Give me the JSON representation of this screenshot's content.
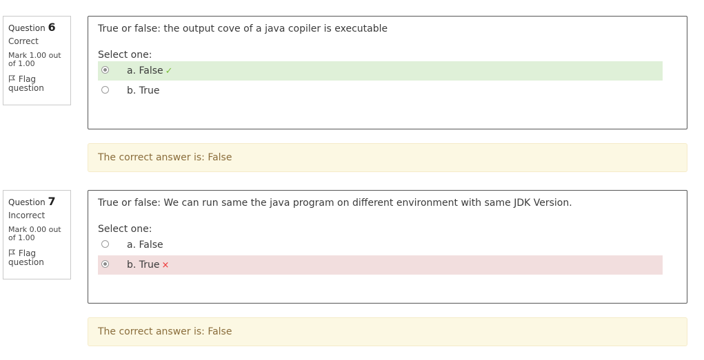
{
  "questions": [
    {
      "label": "Question",
      "number": "6",
      "state": "Correct",
      "grade": "Mark 1.00 out of 1.00",
      "flag": "Flag question",
      "text": "True or false: the output cove of a java copiler is executable",
      "prompt": "Select one:",
      "options": [
        {
          "label": "a. False",
          "selected": true,
          "mark": "✓"
        },
        {
          "label": "b. True",
          "selected": false,
          "mark": ""
        }
      ],
      "feedback": "The correct answer is: False"
    },
    {
      "label": "Question",
      "number": "7",
      "state": "Incorrect",
      "grade": "Mark 0.00 out of 1.00",
      "flag": "Flag question",
      "text": "True or false: We can run same the java program on different environment with same JDK Version.",
      "prompt": "Select one:",
      "options": [
        {
          "label": "a. False",
          "selected": false,
          "mark": ""
        },
        {
          "label": "b. True",
          "selected": true,
          "mark": "×"
        }
      ],
      "feedback": "The correct answer is: False"
    }
  ],
  "colors": {
    "correct_bg": "#dff0d8",
    "incorrect_bg": "#f2dede",
    "feedback_bg": "#fcf8e3",
    "correct_mark": "#7bbf3a",
    "incorrect_mark": "#e33333"
  },
  "icons": {
    "flag": "flag-icon",
    "correct": "check-icon",
    "incorrect": "cross-icon"
  }
}
